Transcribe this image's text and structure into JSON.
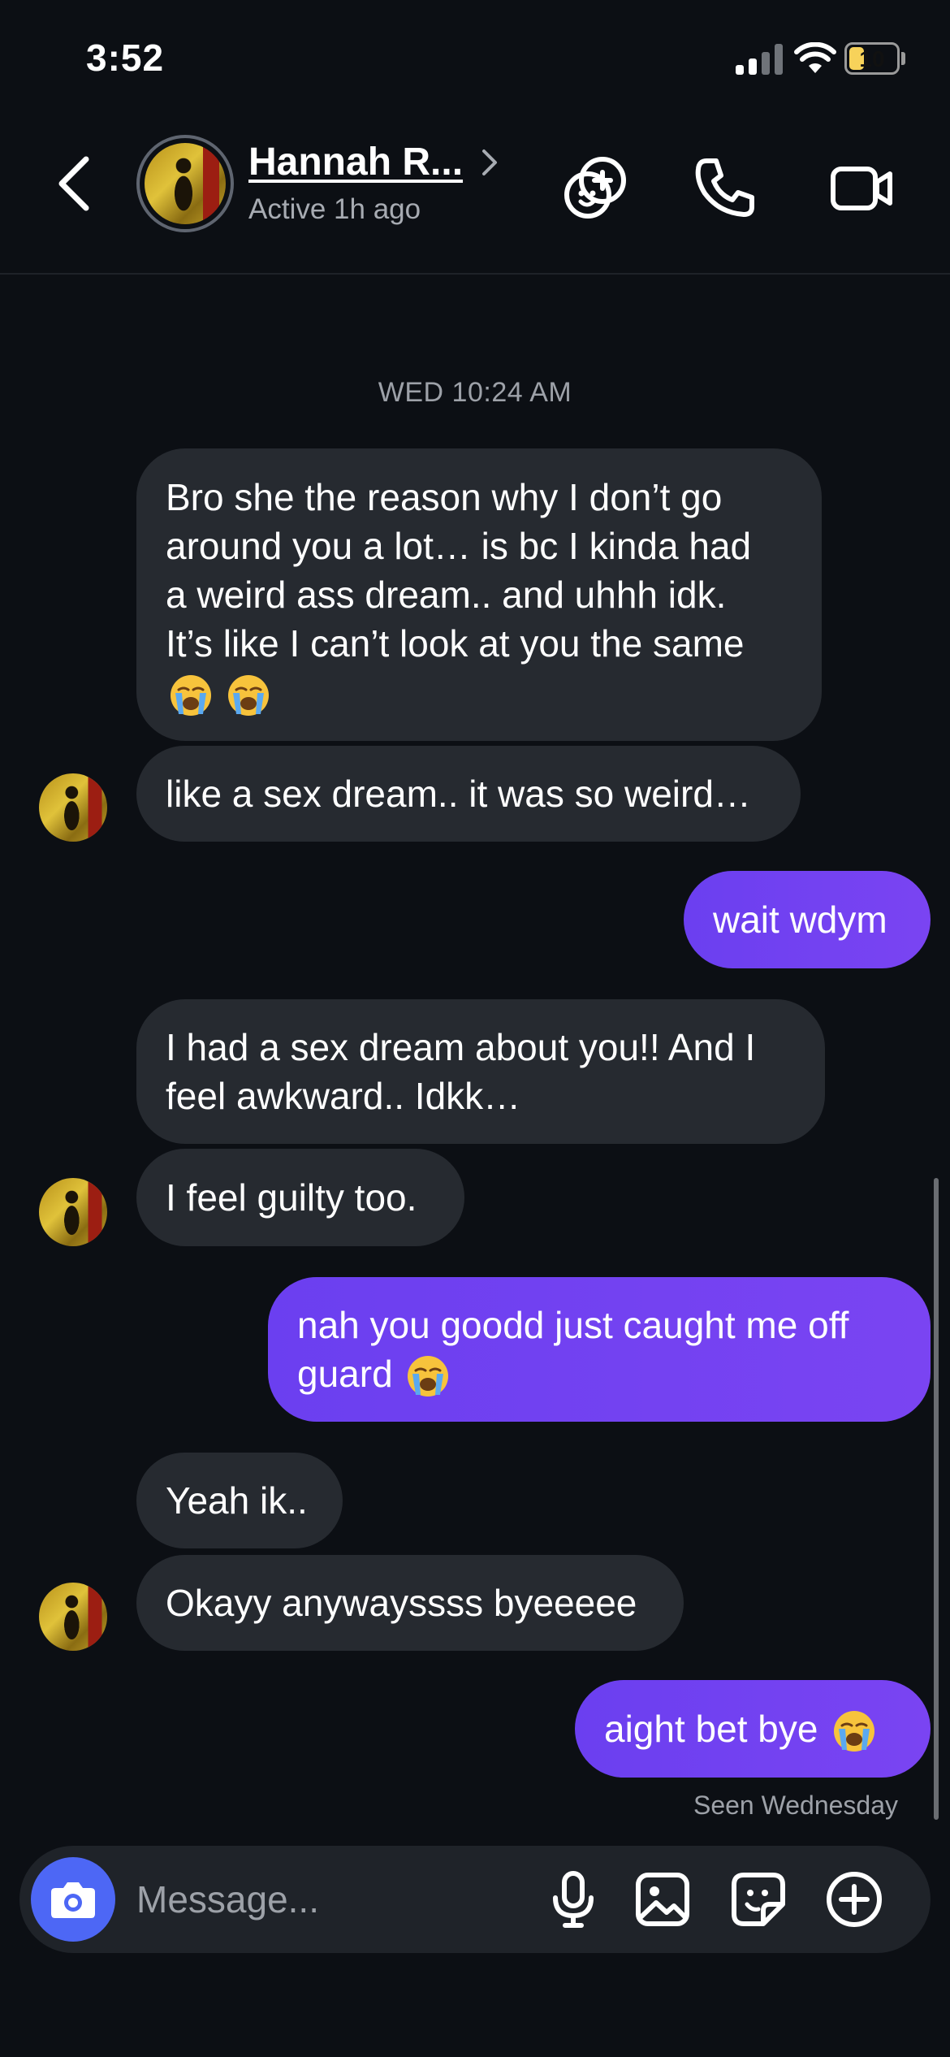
{
  "status_bar": {
    "time": "3:52",
    "battery": "10"
  },
  "header": {
    "back_icon": "chevron-left-icon",
    "contact_name": "Hannah R...",
    "contact_status": "Active 1h ago",
    "icons": [
      "video-chat-effects-icon",
      "phone-icon",
      "video-camera-icon"
    ]
  },
  "conversation": {
    "date_separator": "WED 10:24 AM",
    "messages": [
      {
        "from": "them",
        "text": "Bro she the reason why I don’t go\naround you a lot… is bc I kinda had\na weird ass dream.. and uhhh idk.\nIt’s like I can’t look at you the same",
        "emoji": "😭 😭"
      },
      {
        "from": "them",
        "text": "like a sex dream.. it was so weird…"
      },
      {
        "from": "me",
        "text": "wait wdym"
      },
      {
        "from": "them",
        "text": "I had a sex dream about you!! And I\nfeel awkward.. Idkk…"
      },
      {
        "from": "them",
        "text": "I feel guilty too."
      },
      {
        "from": "me",
        "text": "nah you goodd just caught me off\nguard",
        "emoji": "😭"
      },
      {
        "from": "them",
        "text": "Yeah ik.."
      },
      {
        "from": "them",
        "text": "Okayy anywayssss byeeeee"
      },
      {
        "from": "me",
        "text": "aight bet bye",
        "emoji": "😭"
      }
    ],
    "seen_status": "Seen Wednesday"
  },
  "composer": {
    "placeholder": "Message...",
    "icons": [
      "camera-icon",
      "microphone-icon",
      "gallery-icon",
      "sticker-icon",
      "plus-circle-icon"
    ]
  },
  "colors": {
    "background": "#0c0f14",
    "incoming_bubble": "#262a30",
    "outgoing_bubble": "#6b3ff0",
    "camera_button": "#4d67f5"
  }
}
